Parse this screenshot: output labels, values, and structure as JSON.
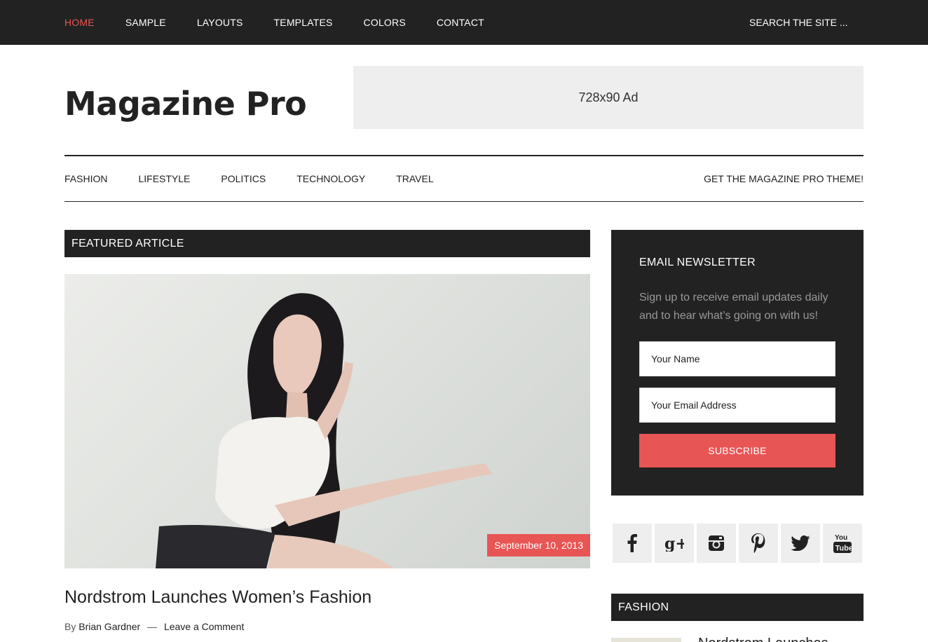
{
  "topnav": {
    "items": [
      "HOME",
      "SAMPLE",
      "LAYOUTS",
      "TEMPLATES",
      "COLORS",
      "CONTACT"
    ],
    "active": "HOME",
    "search_placeholder": "SEARCH THE SITE ..."
  },
  "header": {
    "site_title": "Magazine Pro",
    "ad_label": "728x90 Ad"
  },
  "subnav": {
    "items": [
      "FASHION",
      "LIFESTYLE",
      "POLITICS",
      "TECHNOLOGY",
      "TRAVEL"
    ],
    "promo": "GET THE MAGAZINE PRO THEME!"
  },
  "featured": {
    "section_title": "FEATURED ARTICLE",
    "date": "September 10, 2013",
    "post_title": "Nordstrom Launches Women’s Fashion",
    "by": "By",
    "author": "Brian Gardner",
    "separator": "—",
    "comments": "Leave a Comment"
  },
  "newsletter": {
    "title": "EMAIL NEWSLETTER",
    "text": "Sign up to receive email updates daily and to hear what’s going on with us!",
    "name_placeholder": "Your Name",
    "email_placeholder": "Your Email Address",
    "button": "SUBSCRIBE"
  },
  "social": {
    "icons": [
      "facebook-icon",
      "google-plus-icon",
      "instagram-icon",
      "pinterest-icon",
      "twitter-icon",
      "youtube-icon"
    ]
  },
  "sidebar": {
    "fashion_title": "FASHION",
    "first_post_title": "Nordstrom Launches"
  },
  "colors": {
    "dark": "#222222",
    "accent": "#e85555",
    "light_gray": "#eeeeee"
  }
}
